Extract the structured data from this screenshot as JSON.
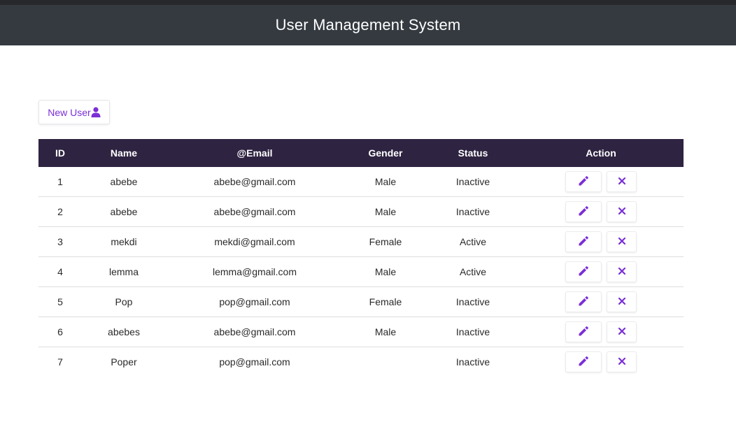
{
  "header": {
    "title": "User Management System"
  },
  "toolbar": {
    "new_user_label": "New User",
    "new_user_icon": "user-icon"
  },
  "accent_color": "#7b2fd6",
  "table": {
    "columns": [
      "ID",
      "Name",
      "@Email",
      "Gender",
      "Status",
      "Action"
    ],
    "rows": [
      {
        "id": "1",
        "name": "abebe",
        "email": "abebe@gmail.com",
        "gender": "Male",
        "status": "Inactive"
      },
      {
        "id": "2",
        "name": "abebe",
        "email": "abebe@gmail.com",
        "gender": "Male",
        "status": "Inactive"
      },
      {
        "id": "3",
        "name": "mekdi",
        "email": "mekdi@gmail.com",
        "gender": "Female",
        "status": "Active"
      },
      {
        "id": "4",
        "name": "lemma",
        "email": "lemma@gmail.com",
        "gender": "Male",
        "status": "Active"
      },
      {
        "id": "5",
        "name": "Pop",
        "email": "pop@gmail.com",
        "gender": "Female",
        "status": "Inactive"
      },
      {
        "id": "6",
        "name": "abebes",
        "email": "abebe@gmail.com",
        "gender": "Male",
        "status": "Inactive"
      },
      {
        "id": "7",
        "name": "Poper",
        "email": "pop@gmail.com",
        "gender": "",
        "status": "Inactive"
      }
    ],
    "row_actions": {
      "edit_icon": "pencil-icon",
      "delete_icon": "close-icon"
    }
  }
}
